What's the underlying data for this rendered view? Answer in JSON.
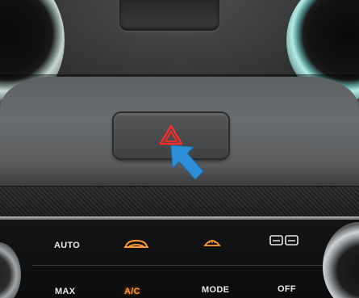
{
  "scene": {
    "hazard_button": {
      "icon": "hazard-triangle-icon",
      "icon_color": "#ff2a2a"
    },
    "pointer_arrow": {
      "icon": "arrow-pointer-icon",
      "color": "#2f8fd6"
    }
  },
  "climate_panel": {
    "auto_label": "AUTO",
    "max_label": "MAX",
    "ac_label": "A/C",
    "mode_label": "MODE",
    "off_label": "OFF",
    "indicator_color": "#ff9a33",
    "icons": [
      "recirculation-icon",
      "front-defrost-icon",
      "rear-defrost-icon"
    ]
  }
}
